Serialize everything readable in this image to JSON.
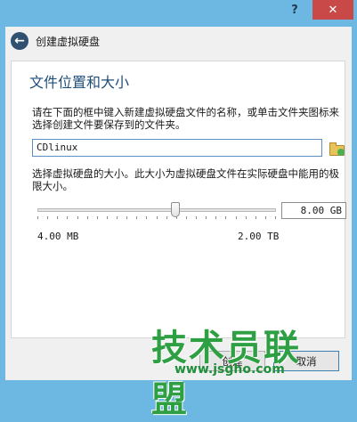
{
  "titlebar": {
    "help_label": "?",
    "close_label": "✕"
  },
  "header": {
    "title": "创建虚拟硬盘"
  },
  "section": {
    "title": "文件位置和大小",
    "location_desc": "请在下面的框中键入新建虚拟硬盘文件的名称，或单击文件夹图标来选择创建文件要保存到的文件夹。",
    "file_name": "CDlinux",
    "size_desc": "选择虚拟硬盘的大小。此大小为虚拟硬盘文件在实际硬盘中能用的极限大小。",
    "size_value": "8.00 GB",
    "slider_fraction": 0.58,
    "range_min": "4.00 MB",
    "range_max": "2.00 TB"
  },
  "footer": {
    "create_label": "创建",
    "cancel_label": "取消"
  },
  "watermark": {
    "title": "技术员联盟",
    "url": "www.jsgho.com"
  },
  "icons": [
    "back-arrow-icon",
    "folder-icon",
    "help-icon",
    "close-icon"
  ]
}
